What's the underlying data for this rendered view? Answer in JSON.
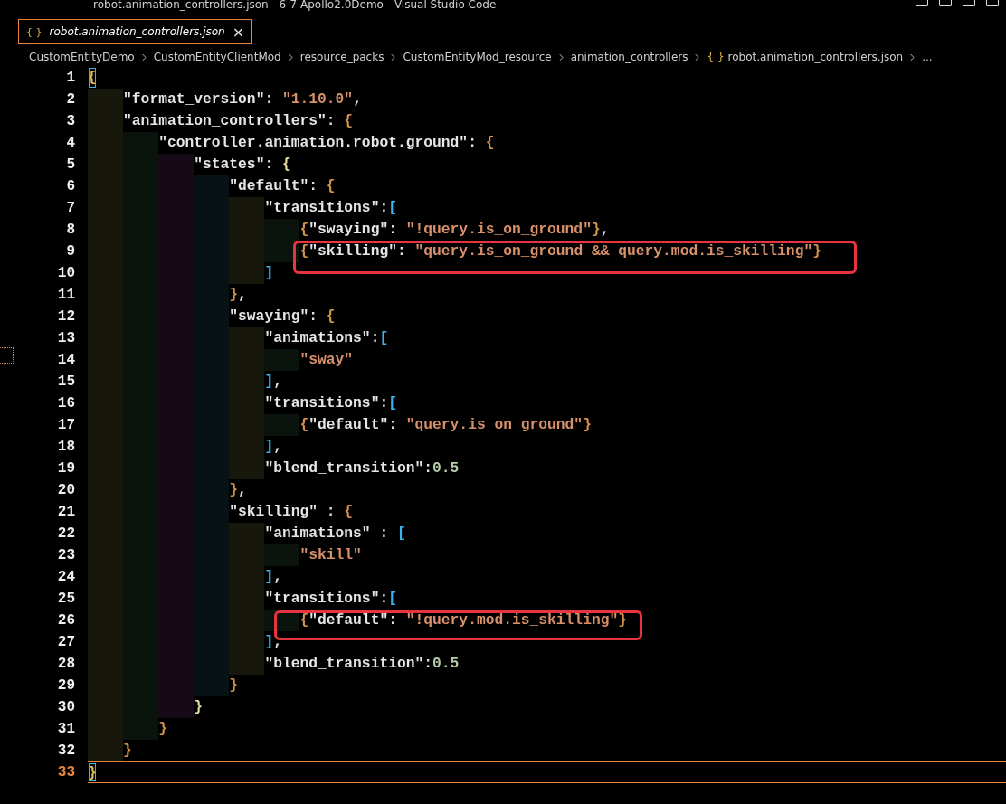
{
  "window": {
    "title": "robot.animation_controllers.json - 6-7 Apollo2.0Demo - Visual Studio Code"
  },
  "tabs": [
    {
      "icon": "{ }",
      "label": "robot.animation_controllers.json",
      "close": "×",
      "selected": true
    }
  ],
  "breadcrumbs": [
    {
      "label": "CustomEntityDemo"
    },
    {
      "label": "CustomEntityClientMod"
    },
    {
      "label": "resource_packs"
    },
    {
      "label": "CustomEntityMod_resource"
    },
    {
      "label": "animation_controllers"
    },
    {
      "icon": "{ }",
      "label": "robot.animation_controllers.json"
    },
    {
      "label": "..."
    }
  ],
  "editor": {
    "lines": [
      {
        "number": "1",
        "current": false,
        "tokens": [
          {
            "text": "{",
            "kind": "brace_match"
          }
        ]
      },
      {
        "number": "2",
        "current": false,
        "guides": [
          {
            "color": "#17170b"
          }
        ],
        "tokens": [
          {
            "text": "\"format_version\"",
            "kind": "key"
          },
          {
            "text": ": ",
            "kind": "punct"
          },
          {
            "text": "\"1.10.0\"",
            "kind": "str"
          },
          {
            "text": ",",
            "kind": "punct"
          }
        ]
      },
      {
        "number": "3",
        "current": false,
        "guides": [
          {
            "color": "#17170b"
          }
        ],
        "tokens": [
          {
            "text": "\"animation_controllers\"",
            "kind": "key"
          },
          {
            "text": ": ",
            "kind": "punct"
          },
          {
            "text": "{",
            "kind": "brace"
          }
        ]
      },
      {
        "number": "4",
        "current": false,
        "guides": [
          {
            "color": "#17170b"
          },
          {
            "color": "#0b140c"
          }
        ],
        "tokens": [
          {
            "text": "\"controller.animation.robot.ground\"",
            "kind": "key"
          },
          {
            "text": ": ",
            "kind": "punct"
          },
          {
            "text": "{",
            "kind": "brace"
          }
        ]
      },
      {
        "number": "5",
        "current": false,
        "guides": [
          {
            "color": "#17170b"
          },
          {
            "color": "#0b140c"
          },
          {
            "color": "#150a16"
          }
        ],
        "tokens": [
          {
            "text": "\"states\"",
            "kind": "key"
          },
          {
            "text": ": ",
            "kind": "punct"
          },
          {
            "text": "{",
            "kind": "brace2"
          }
        ]
      },
      {
        "number": "6",
        "current": false,
        "guides": [
          {
            "color": "#17170b"
          },
          {
            "color": "#0b140c"
          },
          {
            "color": "#150a16"
          },
          {
            "color": "#061214"
          }
        ],
        "tokens": [
          {
            "text": "\"default\"",
            "kind": "key"
          },
          {
            "text": ": ",
            "kind": "punct"
          },
          {
            "text": "{",
            "kind": "brace"
          }
        ]
      },
      {
        "number": "7",
        "current": false,
        "guides": [
          {
            "color": "#17170b"
          },
          {
            "color": "#0b140c"
          },
          {
            "color": "#150a16"
          },
          {
            "color": "#061214"
          },
          {
            "color": "#17170b"
          }
        ],
        "tokens": [
          {
            "text": "\"transitions\"",
            "kind": "key"
          },
          {
            "text": ":",
            "kind": "punct"
          },
          {
            "text": "[",
            "kind": "bracket"
          }
        ]
      },
      {
        "number": "8",
        "current": false,
        "guides": [
          {
            "color": "#17170b"
          },
          {
            "color": "#0b140c"
          },
          {
            "color": "#150a16"
          },
          {
            "color": "#061214"
          },
          {
            "color": "#17170b"
          },
          {
            "color": "#0b140c"
          }
        ],
        "tokens": [
          {
            "text": "{",
            "kind": "brace"
          },
          {
            "text": "\"swaying\"",
            "kind": "key"
          },
          {
            "text": ": ",
            "kind": "punct"
          },
          {
            "text": "\"!query.is_on_ground\"",
            "kind": "str"
          },
          {
            "text": "}",
            "kind": "brace"
          },
          {
            "text": ",",
            "kind": "punct"
          }
        ]
      },
      {
        "number": "9",
        "current": false,
        "guides": [
          {
            "color": "#17170b"
          },
          {
            "color": "#0b140c"
          },
          {
            "color": "#150a16"
          },
          {
            "color": "#061214"
          },
          {
            "color": "#17170b"
          },
          {
            "color": "#0b140c"
          }
        ],
        "tokens": [
          {
            "text": "{",
            "kind": "brace"
          },
          {
            "text": "\"skilling\"",
            "kind": "key"
          },
          {
            "text": ": ",
            "kind": "punct"
          },
          {
            "text": "\"query.is_on_ground && query.mod.is_skilling\"",
            "kind": "str"
          },
          {
            "text": "}",
            "kind": "brace"
          }
        ]
      },
      {
        "number": "10",
        "current": false,
        "guides": [
          {
            "color": "#17170b"
          },
          {
            "color": "#0b140c"
          },
          {
            "color": "#150a16"
          },
          {
            "color": "#061214"
          },
          {
            "color": "#17170b"
          }
        ],
        "tokens": [
          {
            "text": "]",
            "kind": "bracket"
          }
        ]
      },
      {
        "number": "11",
        "current": false,
        "guides": [
          {
            "color": "#17170b"
          },
          {
            "color": "#0b140c"
          },
          {
            "color": "#150a16"
          },
          {
            "color": "#061214"
          }
        ],
        "tokens": [
          {
            "text": "}",
            "kind": "brace"
          },
          {
            "text": ",",
            "kind": "punct"
          }
        ]
      },
      {
        "number": "12",
        "current": false,
        "guides": [
          {
            "color": "#17170b"
          },
          {
            "color": "#0b140c"
          },
          {
            "color": "#150a16"
          },
          {
            "color": "#061214"
          }
        ],
        "tokens": [
          {
            "text": "\"swaying\"",
            "kind": "key"
          },
          {
            "text": ": ",
            "kind": "punct"
          },
          {
            "text": "{",
            "kind": "brace"
          }
        ]
      },
      {
        "number": "13",
        "current": false,
        "guides": [
          {
            "color": "#17170b"
          },
          {
            "color": "#0b140c"
          },
          {
            "color": "#150a16"
          },
          {
            "color": "#061214"
          },
          {
            "color": "#17170b"
          }
        ],
        "tokens": [
          {
            "text": "\"animations\"",
            "kind": "key"
          },
          {
            "text": ":",
            "kind": "punct"
          },
          {
            "text": "[",
            "kind": "bracket"
          }
        ]
      },
      {
        "number": "14",
        "current": false,
        "guides": [
          {
            "color": "#17170b"
          },
          {
            "color": "#0b140c"
          },
          {
            "color": "#150a16"
          },
          {
            "color": "#061214"
          },
          {
            "color": "#17170b"
          },
          {
            "color": "#0b140c"
          }
        ],
        "tokens": [
          {
            "text": "\"sway\"",
            "kind": "str"
          }
        ]
      },
      {
        "number": "15",
        "current": false,
        "guides": [
          {
            "color": "#17170b"
          },
          {
            "color": "#0b140c"
          },
          {
            "color": "#150a16"
          },
          {
            "color": "#061214"
          },
          {
            "color": "#17170b"
          }
        ],
        "tokens": [
          {
            "text": "]",
            "kind": "bracket"
          },
          {
            "text": ",",
            "kind": "punct"
          }
        ]
      },
      {
        "number": "16",
        "current": false,
        "guides": [
          {
            "color": "#17170b"
          },
          {
            "color": "#0b140c"
          },
          {
            "color": "#150a16"
          },
          {
            "color": "#061214"
          },
          {
            "color": "#17170b"
          }
        ],
        "tokens": [
          {
            "text": "\"transitions\"",
            "kind": "key"
          },
          {
            "text": ":",
            "kind": "punct"
          },
          {
            "text": "[",
            "kind": "bracket"
          }
        ]
      },
      {
        "number": "17",
        "current": false,
        "guides": [
          {
            "color": "#17170b"
          },
          {
            "color": "#0b140c"
          },
          {
            "color": "#150a16"
          },
          {
            "color": "#061214"
          },
          {
            "color": "#17170b"
          },
          {
            "color": "#0b140c"
          }
        ],
        "tokens": [
          {
            "text": "{",
            "kind": "brace"
          },
          {
            "text": "\"default\"",
            "kind": "key"
          },
          {
            "text": ": ",
            "kind": "punct"
          },
          {
            "text": "\"query.is_on_ground\"",
            "kind": "str"
          },
          {
            "text": "}",
            "kind": "brace"
          }
        ]
      },
      {
        "number": "18",
        "current": false,
        "guides": [
          {
            "color": "#17170b"
          },
          {
            "color": "#0b140c"
          },
          {
            "color": "#150a16"
          },
          {
            "color": "#061214"
          },
          {
            "color": "#17170b"
          }
        ],
        "tokens": [
          {
            "text": "]",
            "kind": "bracket"
          },
          {
            "text": ",",
            "kind": "punct"
          }
        ]
      },
      {
        "number": "19",
        "current": false,
        "guides": [
          {
            "color": "#17170b"
          },
          {
            "color": "#0b140c"
          },
          {
            "color": "#150a16"
          },
          {
            "color": "#061214"
          },
          {
            "color": "#17170b"
          }
        ],
        "tokens": [
          {
            "text": "\"blend_transition\"",
            "kind": "key"
          },
          {
            "text": ":",
            "kind": "punct"
          },
          {
            "text": "0.5",
            "kind": "num"
          }
        ]
      },
      {
        "number": "20",
        "current": false,
        "guides": [
          {
            "color": "#17170b"
          },
          {
            "color": "#0b140c"
          },
          {
            "color": "#150a16"
          },
          {
            "color": "#061214"
          }
        ],
        "tokens": [
          {
            "text": "}",
            "kind": "brace"
          },
          {
            "text": ",",
            "kind": "punct"
          }
        ]
      },
      {
        "number": "21",
        "current": false,
        "guides": [
          {
            "color": "#17170b"
          },
          {
            "color": "#0b140c"
          },
          {
            "color": "#150a16"
          },
          {
            "color": "#061214"
          }
        ],
        "tokens": [
          {
            "text": "\"skilling\"",
            "kind": "key"
          },
          {
            "text": " : ",
            "kind": "punct"
          },
          {
            "text": "{",
            "kind": "brace"
          }
        ]
      },
      {
        "number": "22",
        "current": false,
        "guides": [
          {
            "color": "#17170b"
          },
          {
            "color": "#0b140c"
          },
          {
            "color": "#150a16"
          },
          {
            "color": "#061214"
          },
          {
            "color": "#17170b"
          }
        ],
        "tokens": [
          {
            "text": "\"animations\"",
            "kind": "key"
          },
          {
            "text": " : ",
            "kind": "punct"
          },
          {
            "text": "[",
            "kind": "bracket"
          }
        ]
      },
      {
        "number": "23",
        "current": false,
        "guides": [
          {
            "color": "#17170b"
          },
          {
            "color": "#0b140c"
          },
          {
            "color": "#150a16"
          },
          {
            "color": "#061214"
          },
          {
            "color": "#17170b"
          },
          {
            "color": "#0b140c"
          }
        ],
        "tokens": [
          {
            "text": "\"skill\"",
            "kind": "str"
          }
        ]
      },
      {
        "number": "24",
        "current": false,
        "guides": [
          {
            "color": "#17170b"
          },
          {
            "color": "#0b140c"
          },
          {
            "color": "#150a16"
          },
          {
            "color": "#061214"
          },
          {
            "color": "#17170b"
          }
        ],
        "tokens": [
          {
            "text": "]",
            "kind": "bracket"
          },
          {
            "text": ",",
            "kind": "punct"
          }
        ]
      },
      {
        "number": "25",
        "current": false,
        "guides": [
          {
            "color": "#17170b"
          },
          {
            "color": "#0b140c"
          },
          {
            "color": "#150a16"
          },
          {
            "color": "#061214"
          },
          {
            "color": "#17170b"
          }
        ],
        "tokens": [
          {
            "text": "\"transitions\"",
            "kind": "key"
          },
          {
            "text": ":",
            "kind": "punct"
          },
          {
            "text": "[",
            "kind": "bracket"
          }
        ]
      },
      {
        "number": "26",
        "current": false,
        "guides": [
          {
            "color": "#17170b"
          },
          {
            "color": "#0b140c"
          },
          {
            "color": "#150a16"
          },
          {
            "color": "#061214"
          },
          {
            "color": "#17170b"
          },
          {
            "color": "#0b140c"
          }
        ],
        "tokens": [
          {
            "text": "{",
            "kind": "brace"
          },
          {
            "text": "\"default\"",
            "kind": "key"
          },
          {
            "text": ": ",
            "kind": "punct"
          },
          {
            "text": "\"!query.mod.is_skilling\"",
            "kind": "str"
          },
          {
            "text": "}",
            "kind": "brace"
          }
        ]
      },
      {
        "number": "27",
        "current": false,
        "guides": [
          {
            "color": "#17170b"
          },
          {
            "color": "#0b140c"
          },
          {
            "color": "#150a16"
          },
          {
            "color": "#061214"
          },
          {
            "color": "#17170b"
          }
        ],
        "tokens": [
          {
            "text": "]",
            "kind": "bracket"
          },
          {
            "text": ",",
            "kind": "punct"
          }
        ]
      },
      {
        "number": "28",
        "current": false,
        "guides": [
          {
            "color": "#17170b"
          },
          {
            "color": "#0b140c"
          },
          {
            "color": "#150a16"
          },
          {
            "color": "#061214"
          },
          {
            "color": "#17170b"
          }
        ],
        "tokens": [
          {
            "text": "\"blend_transition\"",
            "kind": "key"
          },
          {
            "text": ":",
            "kind": "punct"
          },
          {
            "text": "0.5",
            "kind": "num"
          }
        ]
      },
      {
        "number": "29",
        "current": false,
        "guides": [
          {
            "color": "#17170b"
          },
          {
            "color": "#0b140c"
          },
          {
            "color": "#150a16"
          },
          {
            "color": "#061214"
          }
        ],
        "tokens": [
          {
            "text": "}",
            "kind": "brace"
          }
        ]
      },
      {
        "number": "30",
        "current": false,
        "guides": [
          {
            "color": "#17170b"
          },
          {
            "color": "#0b140c"
          },
          {
            "color": "#150a16"
          }
        ],
        "tokens": [
          {
            "text": "}",
            "kind": "brace2"
          }
        ]
      },
      {
        "number": "31",
        "current": false,
        "guides": [
          {
            "color": "#17170b"
          },
          {
            "color": "#0b140c"
          }
        ],
        "tokens": [
          {
            "text": "}",
            "kind": "brace"
          }
        ]
      },
      {
        "number": "32",
        "current": false,
        "guides": [
          {
            "color": "#17170b"
          }
        ],
        "tokens": [
          {
            "text": "}",
            "kind": "brace"
          }
        ]
      },
      {
        "number": "33",
        "current": true,
        "tokens": [
          {
            "text": "}",
            "kind": "brace_match"
          }
        ]
      }
    ],
    "annotations": [
      {
        "kind": "red_box"
      },
      {
        "kind": "red_box"
      }
    ]
  }
}
